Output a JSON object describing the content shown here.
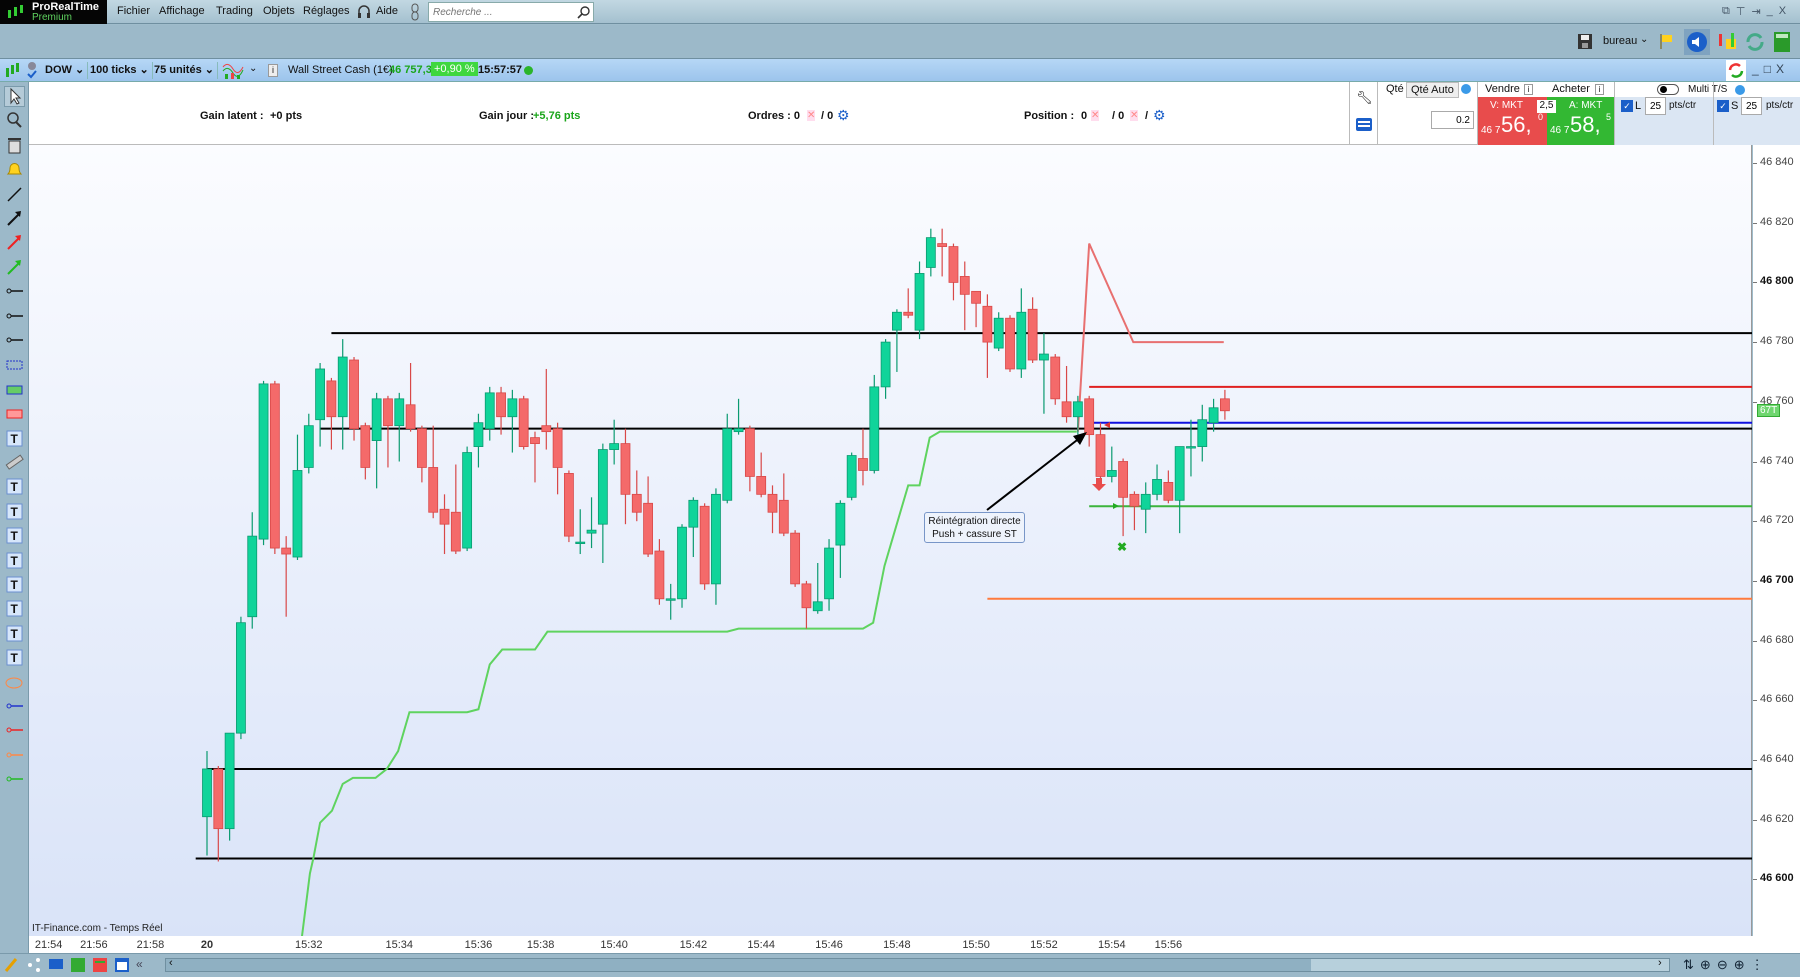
{
  "app": {
    "name": "ProRealTime",
    "edition": "Premium"
  },
  "menu": [
    "Fichier",
    "Affichage",
    "Trading",
    "Objets",
    "Réglages",
    "Aide"
  ],
  "search": {
    "placeholder": "Recherche ..."
  },
  "workspace": {
    "label": "bureau"
  },
  "chart_toolbar": {
    "instrument": "DOW",
    "period": "100 ticks",
    "units": "75 unités",
    "name": "Wall Street Cash (1€)",
    "last": "46 757,3",
    "change": "+0,90 %",
    "time": "15:57:57",
    "status_color": "#2bb52b"
  },
  "info": {
    "gain_latent_label": "Gain latent :",
    "gain_latent": "+0 pts",
    "gain_jour_label": "Gain jour :",
    "gain_jour": "+5,76 pts",
    "ordres_label": "Ordres : 0",
    "ordres_sep": "/ 0",
    "position_label": "Position :",
    "position_a": "0",
    "position_b": "/ 0",
    "position_c": "/"
  },
  "order_panel": {
    "qty_label": "Qté",
    "qty_auto": "Qté Auto",
    "qty_value": "0.2",
    "sell_label": "Vendre",
    "buy_label": "Acheter",
    "spread": "2,5",
    "sell_type": "V: MKT",
    "sell_prefix": "46 7",
    "sell_big": "56,",
    "sell_dec": "0",
    "buy_type": "A: MKT",
    "buy_prefix": "46 7",
    "buy_big": "58,",
    "buy_dec": "5",
    "multi_ts": "Multi T/S",
    "L": "L",
    "S": "S",
    "L_value": "25",
    "S_value": "25",
    "unit": "pts/ctr",
    "sell_color": "#e84c4c",
    "buy_color": "#33b833"
  },
  "source": "IT-Finance.com - Temps Réel",
  "price_label": "67T",
  "annotation": {
    "line1": "Réintégration directe",
    "line2": "Push + cassure ST"
  },
  "left_tools": [
    "cursor-icon",
    "zoom-icon",
    "trash-icon",
    "alert-bell-icon",
    "line-icon",
    "arrow-line-icon",
    "red-arrow-icon",
    "green-arrow-icon",
    "horizontal-line-icon",
    "horizontal-line-icon",
    "horizontal-line-icon",
    "blue-rectangle-icon",
    "green-rectangle-icon",
    "red-rectangle-icon",
    "text-icon",
    "ruler-icon",
    "text-icon",
    "text-icon",
    "text-icon",
    "text-icon",
    "text-icon",
    "text-icon",
    "text-icon",
    "text-icon",
    "ellipse-icon",
    "blue-segment-icon",
    "red-segment-icon",
    "orange-segment-icon",
    "green-segment-icon"
  ],
  "chart_data": {
    "type": "candlestick",
    "ylim": [
      46580,
      46845
    ],
    "yticks": [
      46840,
      46820,
      46800,
      46780,
      46760,
      46740,
      46720,
      46700,
      46680,
      46660,
      46640,
      46620,
      46600
    ],
    "ytick_labels": [
      "46 840",
      "46 820",
      "46 800",
      "46 780",
      "46 760",
      "46 740",
      "46 720",
      "46 700",
      "46 680",
      "46 660",
      "46 640",
      "46 620",
      "46 600"
    ],
    "xtick_labels": [
      {
        "label": "21:54",
        "bar": -14
      },
      {
        "label": "21:56",
        "bar": -10
      },
      {
        "label": "21:58",
        "bar": -5
      },
      {
        "label": "20",
        "bar": 0
      },
      {
        "label": "15:32",
        "bar": 9
      },
      {
        "label": "15:34",
        "bar": 17
      },
      {
        "label": "15:36",
        "bar": 24
      },
      {
        "label": "15:38",
        "bar": 29.5
      },
      {
        "label": "15:40",
        "bar": 36
      },
      {
        "label": "15:42",
        "bar": 43
      },
      {
        "label": "15:44",
        "bar": 49
      },
      {
        "label": "15:46",
        "bar": 55
      },
      {
        "label": "15:48",
        "bar": 61
      },
      {
        "label": "15:50",
        "bar": 68
      },
      {
        "label": "15:52",
        "bar": 74
      },
      {
        "label": "15:54",
        "bar": 80
      },
      {
        "label": "15:56",
        "bar": 85
      }
    ],
    "up_color": "#10d49a",
    "down_color": "#f46a6a",
    "ohlc": [
      [
        46621,
        46643,
        46608,
        46637
      ],
      [
        46637,
        46638,
        46606,
        46617
      ],
      [
        46617,
        46649,
        46613,
        46649
      ],
      [
        46649,
        46688,
        46647,
        46686
      ],
      [
        46688,
        46723,
        46684,
        46715
      ],
      [
        46714,
        46767,
        46712,
        46766
      ],
      [
        46766,
        46767,
        46709,
        46711
      ],
      [
        46711,
        46715,
        46688,
        46709
      ],
      [
        46708,
        46749,
        46707,
        46737
      ],
      [
        46738,
        46756,
        46736,
        46752
      ],
      [
        46754,
        46773,
        46745,
        46771
      ],
      [
        46767,
        46768,
        46744,
        46755
      ],
      [
        46755,
        46781,
        46744,
        46775
      ],
      [
        46774,
        46775,
        46747,
        46751
      ],
      [
        46752,
        46753,
        46734,
        46738
      ],
      [
        46747,
        46763,
        46731,
        46761
      ],
      [
        46761,
        46762,
        46738,
        46752
      ],
      [
        46752,
        46763,
        46740,
        46761
      ],
      [
        46759,
        46773,
        46750,
        46751
      ],
      [
        46751,
        46752,
        46733,
        46738
      ],
      [
        46738,
        46752,
        46721,
        46723
      ],
      [
        46724,
        46729,
        46709,
        46719
      ],
      [
        46723,
        46739,
        46709,
        46710
      ],
      [
        46711,
        46745,
        46710,
        46743
      ],
      [
        46745,
        46756,
        46738,
        46753
      ],
      [
        46751,
        46765,
        46747,
        46763
      ],
      [
        46763,
        46765,
        46749,
        46755
      ],
      [
        46755,
        46764,
        46743,
        46761
      ],
      [
        46761,
        46762,
        46744,
        46745
      ],
      [
        46748,
        46750,
        46733,
        46746
      ],
      [
        46752,
        46771,
        46744,
        46750
      ],
      [
        46751,
        46753,
        46729,
        46738
      ],
      [
        46736,
        46737,
        46713,
        46715
      ],
      [
        46713,
        46724,
        46709,
        46713
      ],
      [
        46716,
        46728,
        46711,
        46717
      ],
      [
        46719,
        46746,
        46706,
        46744
      ],
      [
        46744,
        46754,
        46739,
        46746
      ],
      [
        46746,
        46751,
        46719,
        46729
      ],
      [
        46729,
        46737,
        46720,
        46723
      ],
      [
        46726,
        46735,
        46708,
        46709
      ],
      [
        46710,
        46714,
        46692,
        46694
      ],
      [
        46694,
        46699,
        46687,
        46694
      ],
      [
        46694,
        46719,
        46691,
        46718
      ],
      [
        46718,
        46728,
        46708,
        46727
      ],
      [
        46725,
        46726,
        46697,
        46699
      ],
      [
        46699,
        46731,
        46692,
        46729
      ],
      [
        46727,
        46756,
        46726,
        46751
      ],
      [
        46750,
        46761,
        46749,
        46751
      ],
      [
        46751,
        46752,
        46730,
        46735
      ],
      [
        46735,
        46743,
        46728,
        46729
      ],
      [
        46729,
        46732,
        46716,
        46723
      ],
      [
        46727,
        46736,
        46715,
        46716
      ],
      [
        46716,
        46717,
        46698,
        46699
      ],
      [
        46699,
        46700,
        46684,
        46691
      ],
      [
        46690,
        46706,
        46689,
        46693
      ],
      [
        46694,
        46714,
        46690,
        46711
      ],
      [
        46712,
        46727,
        46701,
        46726
      ],
      [
        46728,
        46743,
        46727,
        46742
      ],
      [
        46741,
        46751,
        46732,
        46737
      ],
      [
        46737,
        46769,
        46736,
        46765
      ],
      [
        46765,
        46781,
        46761,
        46780
      ],
      [
        46784,
        46791,
        46770,
        46790
      ],
      [
        46790,
        46798,
        46788,
        46789
      ],
      [
        46784,
        46807,
        46781,
        46803
      ],
      [
        46805,
        46818,
        46802,
        46815
      ],
      [
        46813,
        46818,
        46802,
        46812
      ],
      [
        46812,
        46813,
        46794,
        46800
      ],
      [
        46802,
        46807,
        46784,
        46796
      ],
      [
        46797,
        46797,
        46785,
        46793
      ],
      [
        46792,
        46796,
        46768,
        46780
      ],
      [
        46778,
        46790,
        46777,
        46788
      ],
      [
        46788,
        46789,
        46770,
        46771
      ],
      [
        46771,
        46798,
        46768,
        46790
      ],
      [
        46791,
        46795,
        46773,
        46774
      ],
      [
        46774,
        46783,
        46756,
        46776
      ],
      [
        46775,
        46776,
        46759,
        46761
      ],
      [
        46760,
        46772,
        46753,
        46755
      ],
      [
        46755,
        46762,
        46749,
        46760
      ],
      [
        46761,
        46762,
        46745,
        46749
      ],
      [
        46749,
        46753,
        46733,
        46735
      ],
      [
        46735,
        46745,
        46733,
        46737
      ],
      [
        46740,
        46741,
        46715,
        46728
      ],
      [
        46729,
        46730,
        46717,
        46725
      ],
      [
        46724,
        46733,
        46716,
        46729
      ],
      [
        46729,
        46739,
        46727,
        46734
      ],
      [
        46733,
        46737,
        46726,
        46727
      ],
      [
        46727,
        46745,
        46716,
        46745
      ],
      [
        46745,
        46754,
        46735,
        46745
      ],
      [
        46745,
        46759,
        46740,
        46754
      ],
      [
        46753,
        46761,
        46750,
        46758
      ],
      [
        46761,
        46764,
        46754,
        46757
      ]
    ],
    "trailing_stop": {
      "color": "#5fd35f",
      "points": [
        [
          8.4,
          46581
        ],
        [
          9.1,
          46602
        ],
        [
          9.4,
          46607
        ],
        [
          10,
          46619
        ],
        [
          11.05,
          46623
        ],
        [
          12,
          46632
        ],
        [
          12.9,
          46634
        ],
        [
          14.9,
          46634
        ],
        [
          15.9,
          46637
        ],
        [
          16.9,
          46643
        ],
        [
          17.9,
          46656
        ],
        [
          23,
          46656
        ],
        [
          24,
          46657
        ],
        [
          25,
          46672
        ],
        [
          26.1,
          46677
        ],
        [
          29,
          46677
        ],
        [
          30.1,
          46683
        ],
        [
          46,
          46683
        ],
        [
          47,
          46684
        ],
        [
          58,
          46684
        ],
        [
          58.9,
          46686
        ],
        [
          59.9,
          46705
        ],
        [
          62,
          46732
        ],
        [
          63,
          46732
        ],
        [
          63.9,
          46748
        ],
        [
          64.8,
          46750
        ],
        [
          76.9,
          46750
        ]
      ]
    },
    "stop_short": {
      "color": "#e87070",
      "points": [
        [
          77,
          46750
        ],
        [
          78,
          46813
        ],
        [
          81.9,
          46780
        ],
        [
          89.9,
          46780
        ]
      ]
    },
    "hlines": [
      {
        "price": 46783,
        "from_bar": 11,
        "color": "#000000"
      },
      {
        "price": 46751,
        "from_bar": 10,
        "color": "#000000"
      },
      {
        "price": 46637,
        "from_bar": 0,
        "color": "#000000"
      },
      {
        "price": 46607,
        "from_bar": -1,
        "color": "#000000"
      },
      {
        "price": 46765,
        "from_bar": 78,
        "color": "#e02020"
      },
      {
        "price": 46753,
        "from_bar": 78,
        "color": "#1010e0"
      },
      {
        "price": 46725,
        "from_bar": 78,
        "color": "#3cb43c"
      },
      {
        "price": 46694,
        "from_bar": 69,
        "color": "#ff7a3c"
      }
    ]
  }
}
